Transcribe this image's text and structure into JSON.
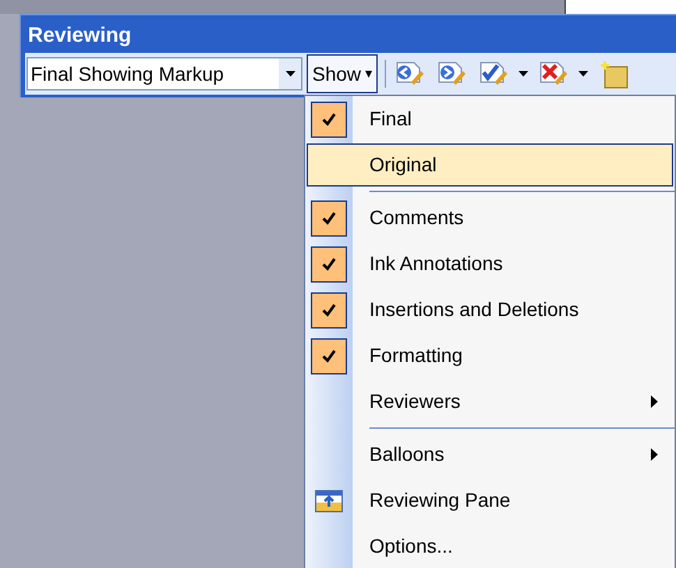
{
  "toolbar": {
    "title": "Reviewing",
    "display_mode": "Final Showing Markup",
    "show_button": {
      "label": "Show",
      "caret": "▾",
      "pressed": true
    }
  },
  "menu": [
    {
      "kind": "item",
      "label": "Final",
      "checked": true,
      "selected": false
    },
    {
      "kind": "item",
      "label": "Original",
      "checked": false,
      "selected": true
    },
    {
      "kind": "separator"
    },
    {
      "kind": "item",
      "label": "Comments",
      "checked": true,
      "selected": false
    },
    {
      "kind": "item",
      "label": "Ink Annotations",
      "checked": true,
      "selected": false
    },
    {
      "kind": "item",
      "label": "Insertions and Deletions",
      "checked": true,
      "selected": false
    },
    {
      "kind": "item",
      "label": "Formatting",
      "checked": true,
      "selected": false
    },
    {
      "kind": "submenu",
      "label": "Reviewers",
      "checked": false,
      "selected": false
    },
    {
      "kind": "separator"
    },
    {
      "kind": "submenu",
      "label": "Balloons",
      "checked": false,
      "selected": false
    },
    {
      "kind": "icon",
      "label": "Reviewing Pane",
      "checked": false,
      "selected": false
    },
    {
      "kind": "item",
      "label": "Options...",
      "checked": false,
      "selected": false
    }
  ]
}
